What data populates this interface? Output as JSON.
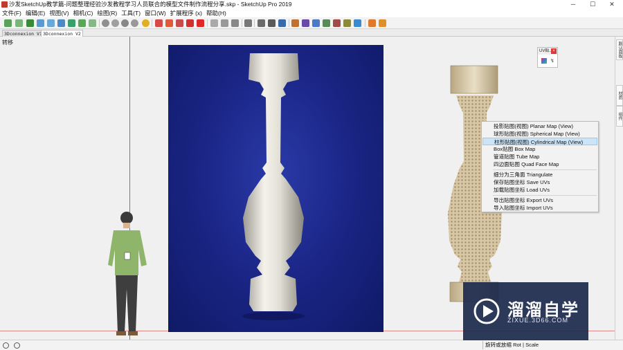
{
  "window": {
    "title": "沙发SketchUp教学篇-问题整理经验沙发教程学习人员联合的模型文件制作流程分享.skp - SketchUp Pro 2019",
    "minimize": "─",
    "maximize": "☐",
    "close": "✕"
  },
  "menu": [
    "文件(F)",
    "编辑(E)",
    "视图(V)",
    "相机(C)",
    "绘图(R)",
    "工具(T)",
    "窗口(W)",
    "扩展程序 (x)",
    "帮助(H)"
  ],
  "tabs": [
    "3Dconnexion V1",
    "3Dconnexion V2"
  ],
  "scene": {
    "label": "转移"
  },
  "uv_toolbar": {
    "title": "UV贴...",
    "close": "×",
    "tool_glyph": "↯"
  },
  "context_menu": {
    "items": [
      {
        "label": "投影贴图(视图) Planar Map (View)",
        "highlighted": false
      },
      {
        "label": "球形贴图(视图) Spherical Map (View)",
        "highlighted": false
      },
      {
        "label": "柱形贴图(视图) Cylindrical Map (View)",
        "highlighted": true
      },
      {
        "label": "Box贴图 Box Map",
        "highlighted": false
      },
      {
        "label": "管道贴图 Tube Map",
        "highlighted": false
      },
      {
        "label": "四边面贴图 Quad Face Map",
        "highlighted": false
      },
      {
        "label": "细分为三角面 Triangulate",
        "highlighted": false
      },
      {
        "label": "保存贴图坐标 Save UVs",
        "highlighted": false
      },
      {
        "label": "加载贴图坐标 Load UVs",
        "highlighted": false
      },
      {
        "label": "导出贴图坐标 Export UVs",
        "highlighted": false
      },
      {
        "label": "导入贴图坐标 Import UVs",
        "highlighted": false
      }
    ]
  },
  "right_panel_tabs": [
    "默认面板",
    "材质",
    "组件"
  ],
  "status": {
    "measurements": "旋转或放缩 Rot | Scale"
  },
  "watermark": {
    "main": "溜溜自学",
    "url": "ZIXUE.3D66.COM"
  },
  "colors": {
    "photo_bg": "#1a2585",
    "highlight": "#cce4f7",
    "axis_blue": "#6a6af0",
    "axis_red": "#e08a8a"
  }
}
